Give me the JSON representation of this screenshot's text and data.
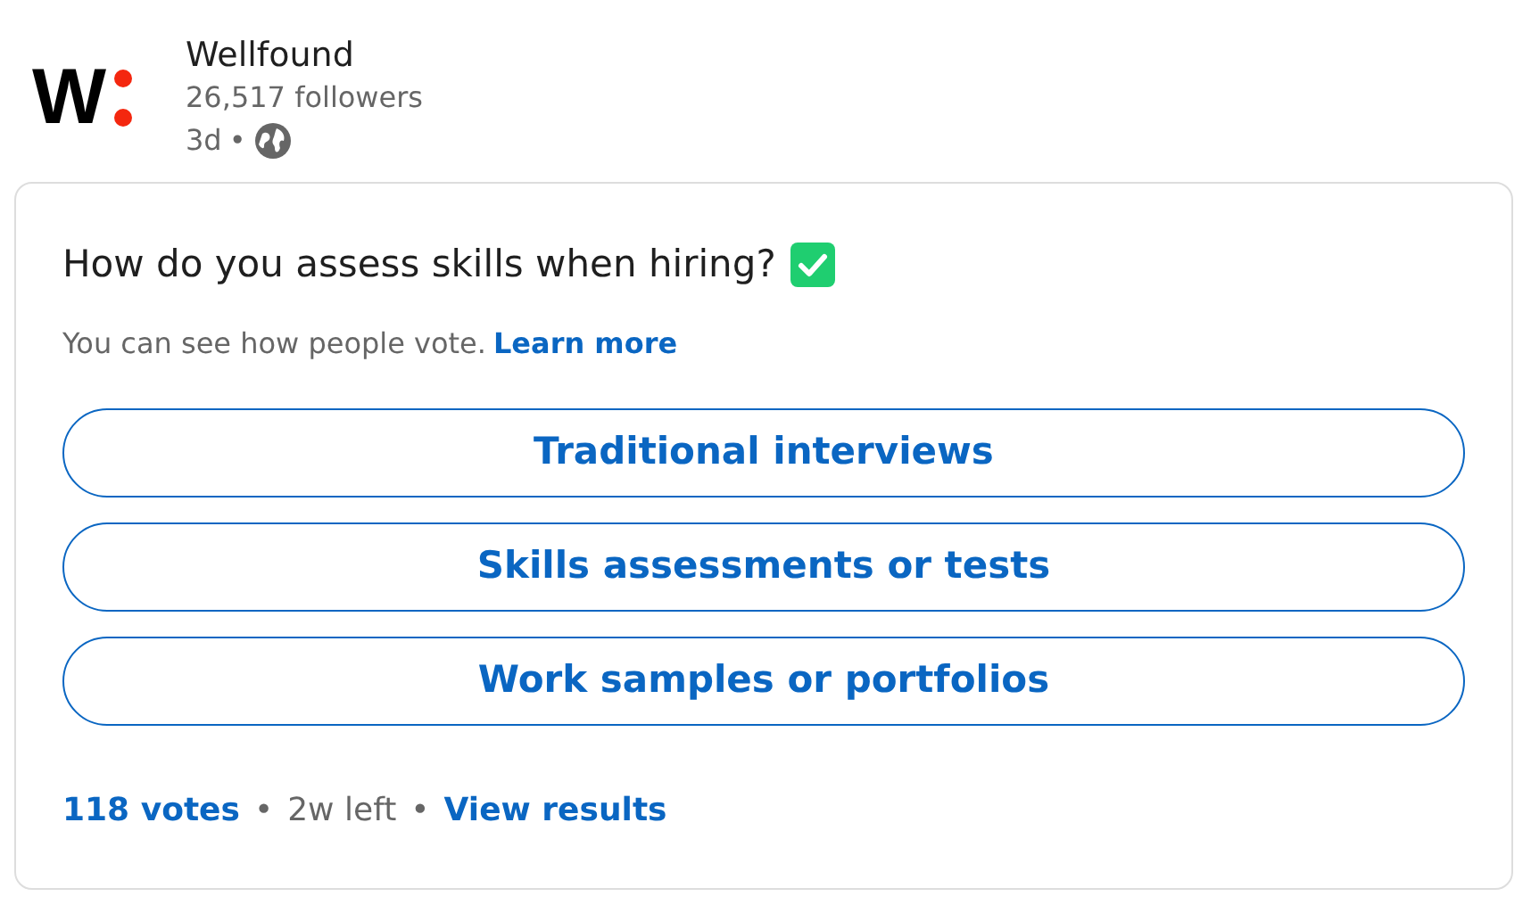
{
  "author": {
    "logo_text": "W",
    "name": "Wellfound",
    "followers": "26,517 followers",
    "age": "3d",
    "separator": "•"
  },
  "poll": {
    "question": "How do you assess skills when hiring?",
    "note": "You can see how people vote.",
    "note_link": "Learn more",
    "options": [
      {
        "label": "Traditional interviews"
      },
      {
        "label": "Skills assessments or tests"
      },
      {
        "label": "Work samples or portfolios"
      }
    ],
    "footer": {
      "votes": "118 votes",
      "sep1": "•",
      "time_left": "2w left",
      "sep2": "•",
      "results_link": "View results"
    }
  }
}
